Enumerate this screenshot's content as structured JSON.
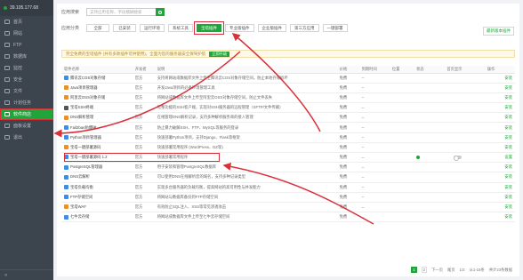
{
  "server": {
    "ip": "39.105.177.68"
  },
  "sidebar": {
    "items": [
      {
        "label": "首页"
      },
      {
        "label": "网站"
      },
      {
        "label": "FTP"
      },
      {
        "label": "数据库"
      },
      {
        "label": "监控"
      },
      {
        "label": "安全"
      },
      {
        "label": "文件"
      },
      {
        "label": "计划任务"
      },
      {
        "label": "软件商店"
      },
      {
        "label": "面板设置"
      },
      {
        "label": "退出"
      }
    ],
    "active_index": 8,
    "collapse_icon": "double-arrow-icon"
  },
  "search": {
    "label": "应用搜索",
    "placeholder": "支持应用名称、字段模糊搜索"
  },
  "categories": {
    "label": "应用分类",
    "tabs": [
      "全部",
      "已安装",
      "运行环境",
      "系统工具",
      "宝塔插件",
      "专业版插件",
      "企业版插件",
      "第三方应用",
      "一键部署"
    ],
    "active_index": 4,
    "right_link": "最新版本插件"
  },
  "notice": {
    "text": "完全免费的宝塔插件 (共有多款插件可供使用)，全面为您的服务器安全保驾护航",
    "button": "立即升级"
  },
  "table": {
    "headers": [
      "软件名称",
      "开发者",
      "说明",
      "价格",
      "到期时间",
      "位置",
      "状态",
      "首页显示",
      "操作"
    ],
    "rows": [
      {
        "name": "腾讯云COS对象存储",
        "dev": "官方",
        "desc": "支持将网站或数据库文件上传至腾讯云COS对象存储空间，防止本地存储损坏",
        "price": "免费",
        "expire": "--",
        "color": "#3a8ee6",
        "action": "安装"
      },
      {
        "name": "Java项目管理器",
        "dev": "官方",
        "desc": "开发Java项目的必备环境管理工具",
        "price": "免费",
        "expire": "--",
        "color": "#e8902c",
        "action": "安装"
      },
      {
        "name": "阿里云OSS对象存储",
        "dev": "官方",
        "desc": "将网站或数据库文件上传至阿里云OSS对象存储空间，防止文件丢失",
        "price": "免费",
        "expire": "--",
        "color": "#e8902c",
        "action": "安装"
      },
      {
        "name": "宝塔SSH终端",
        "dev": "官方",
        "desc": "完整功能的SSH客户端，实现对SSH服务器的远程管理（SFTP/文件传输）",
        "price": "免费",
        "expire": "--",
        "color": "#555555",
        "action": "安装"
      },
      {
        "name": "DNS解析管理",
        "dev": "官方",
        "desc": "在线管理DNS解析记录，支持多种解析服务商的接入管理",
        "price": "免费",
        "expire": "--",
        "color": "#e8902c",
        "action": "安装"
      },
      {
        "name": "Fail2ban防爆破",
        "dev": "官方",
        "desc": "防止暴力破解SSH、FTP、MySQL等服务的登录",
        "price": "免费",
        "expire": "--",
        "color": "#3a8ee6",
        "action": "安装"
      },
      {
        "name": "Python项目管理器",
        "dev": "官方",
        "desc": "快速部署Python项目，支持Django、Flask等框架",
        "price": "免费",
        "expire": "--",
        "color": "#3a8ee6",
        "action": "安装"
      },
      {
        "name": "宝塔一键部署源码",
        "dev": "官方",
        "desc": "快速部署常用程序 (WordPress、DZ等)",
        "price": "免费",
        "expire": "--",
        "color": "#e8902c",
        "action": "安装"
      },
      {
        "name": "宝塔一键部署源码 1.2",
        "dev": "官方",
        "desc": "快速部署常用程序",
        "price": "免费",
        "expire": "--",
        "color": "#3a8ee6",
        "action": "设置",
        "installed": true
      },
      {
        "name": "PostgreSQL管理器",
        "dev": "官方",
        "desc": "用于安装和管理PostgreSQL数据库",
        "price": "免费",
        "expire": "--",
        "color": "#3a8ee6",
        "action": "安装"
      },
      {
        "name": "DNS云解析",
        "dev": "官方",
        "desc": "可以使用DNS在线解析您的域名，支持多种记录类型",
        "price": "免费",
        "expire": "--",
        "color": "#3a8ee6",
        "action": "安装"
      },
      {
        "name": "宝塔负载均衡",
        "dev": "官方",
        "desc": "实现多台服务器的负载均衡，提高网站的高可用性与并发能力",
        "price": "免费",
        "expire": "--",
        "color": "#3a8ee6",
        "action": "安装"
      },
      {
        "name": "FTP存储空间",
        "dev": "官方",
        "desc": "将网站与数据库备份到FTP存储空间",
        "price": "免费",
        "expire": "--",
        "color": "#3a8ee6",
        "action": "安装"
      },
      {
        "name": "宝塔WAF",
        "dev": "官方",
        "desc": "有效防止SQL注入、XSS等常见渗透攻击",
        "price": "免费",
        "expire": "--",
        "color": "#e8902c",
        "action": "安装"
      },
      {
        "name": "七牛云存储",
        "dev": "官方",
        "desc": "将网站或数据库文件上传至七牛云存储空间",
        "price": "免费",
        "expire": "--",
        "color": "#3a8ee6",
        "action": "安装"
      }
    ]
  },
  "pager": {
    "pages": [
      "1",
      "2"
    ],
    "current": "1",
    "next": "下一页",
    "last": "尾页",
    "info": "1/2",
    "from": "从1-15条",
    "total": "共计23条数据"
  }
}
